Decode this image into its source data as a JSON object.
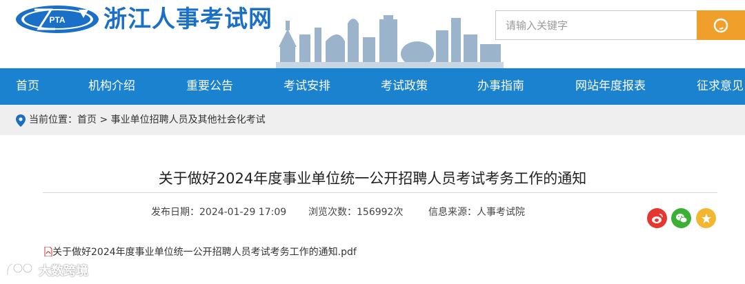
{
  "header": {
    "logo_text": "PTA",
    "site_name": "浙江人事考试网",
    "search": {
      "placeholder": "请输入关键字"
    },
    "colors": {
      "brand_blue": "#1a6fc6",
      "search_orange": "#f0a02a"
    }
  },
  "nav": {
    "items": [
      {
        "label": "首页"
      },
      {
        "label": "机构介绍"
      },
      {
        "label": "重要公告"
      },
      {
        "label": "考试安排"
      },
      {
        "label": "考试政策"
      },
      {
        "label": "办事指南"
      },
      {
        "label": "网站年度报表"
      },
      {
        "label": "征求意见"
      }
    ],
    "color": "#1b82cf"
  },
  "breadcrumb": {
    "prefix": "当前位置：",
    "home": "首页",
    "separator": " > ",
    "current": "事业单位招聘人员及其他社会化考试"
  },
  "article": {
    "title": "关于做好2024年度事业单位统一公开招聘人员考试考务工作的通知",
    "publish_date": "发布日期：2024-01-29 17:09",
    "views": "浏览次数：156992次",
    "source": "信息来源：人事考试院",
    "attachment": "关于做好2024年度事业单位统一公开招聘人员考试考务工作的通知.pdf"
  },
  "share": {
    "icons": [
      "weibo-icon",
      "wechat-icon",
      "favorite-star-icon"
    ],
    "colors": {
      "weibo": "#e6362f",
      "wechat": "#3cb035",
      "favorite": "#f2b631"
    }
  },
  "watermark": {
    "text": "大数跨境"
  }
}
